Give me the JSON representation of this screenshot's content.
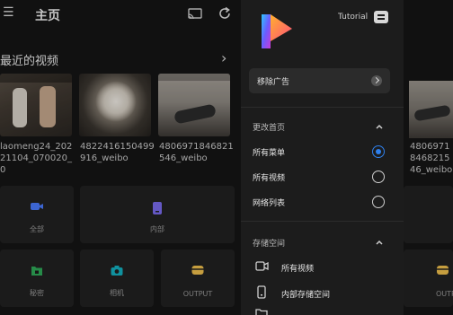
{
  "home": {
    "title": "主页",
    "recent_title": "最近的视频",
    "recent_more": "›",
    "videos": [
      {
        "caption": "laomeng24_20221104_070020_0"
      },
      {
        "caption": "4822416150499916_weibo"
      },
      {
        "caption": "4806971846821546_weibo"
      }
    ],
    "tiles": {
      "all": "全部",
      "internal": "内部",
      "private": "秘密",
      "camera": "相机",
      "output": "OUTPUT"
    },
    "right_sliver": {
      "caption": "4806971846821546_weibo",
      "output_label": "OUTP"
    }
  },
  "drawer": {
    "tutorial_label": "Tutorial",
    "remove_ads": "移除广告",
    "change_home": {
      "title": "更改首页",
      "options": [
        {
          "label": "所有菜单",
          "selected": true
        },
        {
          "label": "所有视频",
          "selected": false
        },
        {
          "label": "网络列表",
          "selected": false
        }
      ]
    },
    "storage": {
      "title": "存储空间",
      "items": [
        {
          "label": "所有视频",
          "icon": "video-camera-icon"
        },
        {
          "label": "内部存储空间",
          "icon": "phone-storage-icon"
        }
      ]
    }
  },
  "colors": {
    "accent": "#2f80ed",
    "icon_blue": "#4a7cff",
    "icon_purple": "#7b6cf0",
    "icon_green": "#2faa58",
    "icon_teal": "#14b3c2",
    "icon_yellow": "#f2c14e"
  }
}
